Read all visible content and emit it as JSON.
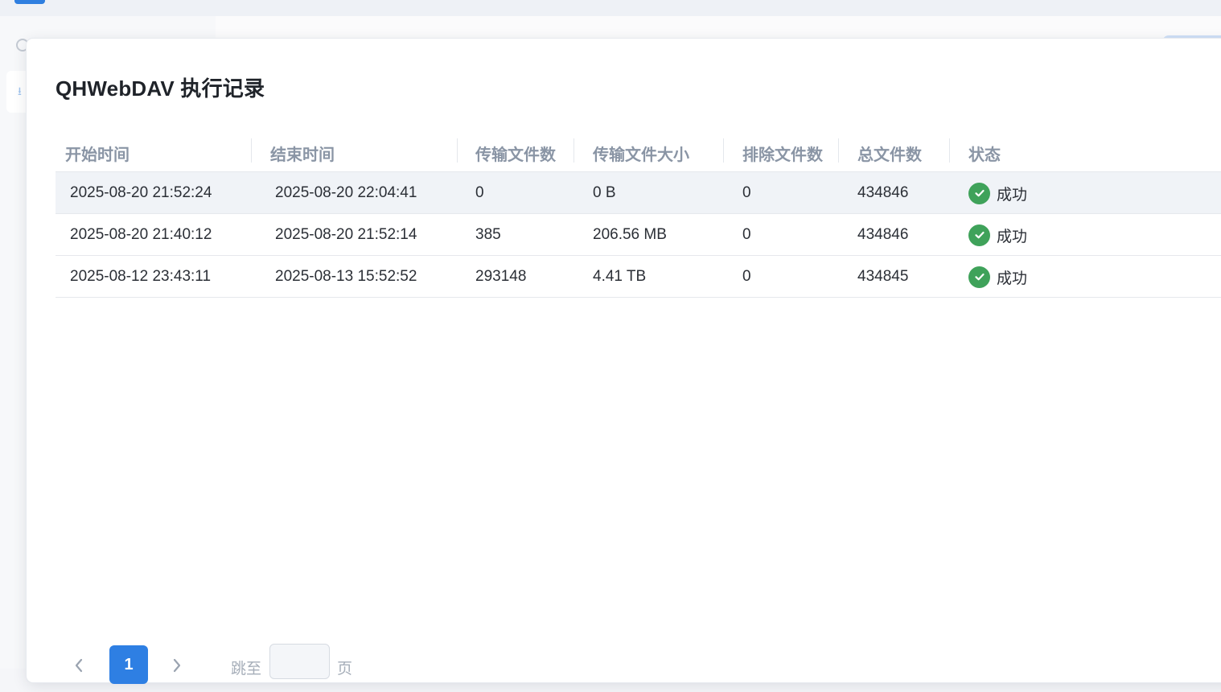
{
  "modal": {
    "title": "QHWebDAV 执行记录"
  },
  "table": {
    "headers": [
      "开始时间",
      "结束时间",
      "传输文件数",
      "传输文件大小",
      "排除文件数",
      "总文件数",
      "状态"
    ],
    "rows": [
      [
        "2025-08-20 21:52:24",
        "2025-08-20 22:04:41",
        "0",
        "0 B",
        "0",
        "434846",
        "成功"
      ],
      [
        "2025-08-20 21:40:12",
        "2025-08-20 21:52:14",
        "385",
        "206.56 MB",
        "0",
        "434846",
        "成功"
      ],
      [
        "2025-08-12 23:43:11",
        "2025-08-13 15:52:52",
        "293148",
        "4.41 TB",
        "0",
        "434845",
        "成功"
      ]
    ]
  },
  "pagination": {
    "prev_icon": "chevron-left-icon",
    "next_icon": "chevron-right-icon",
    "current_page": "1",
    "jump_label": "跳至",
    "jump_value": "",
    "jump_suffix": "页"
  },
  "colors": {
    "accent": "#2e7fe3",
    "success": "#3fa25a",
    "header_text": "#8a95a5"
  }
}
